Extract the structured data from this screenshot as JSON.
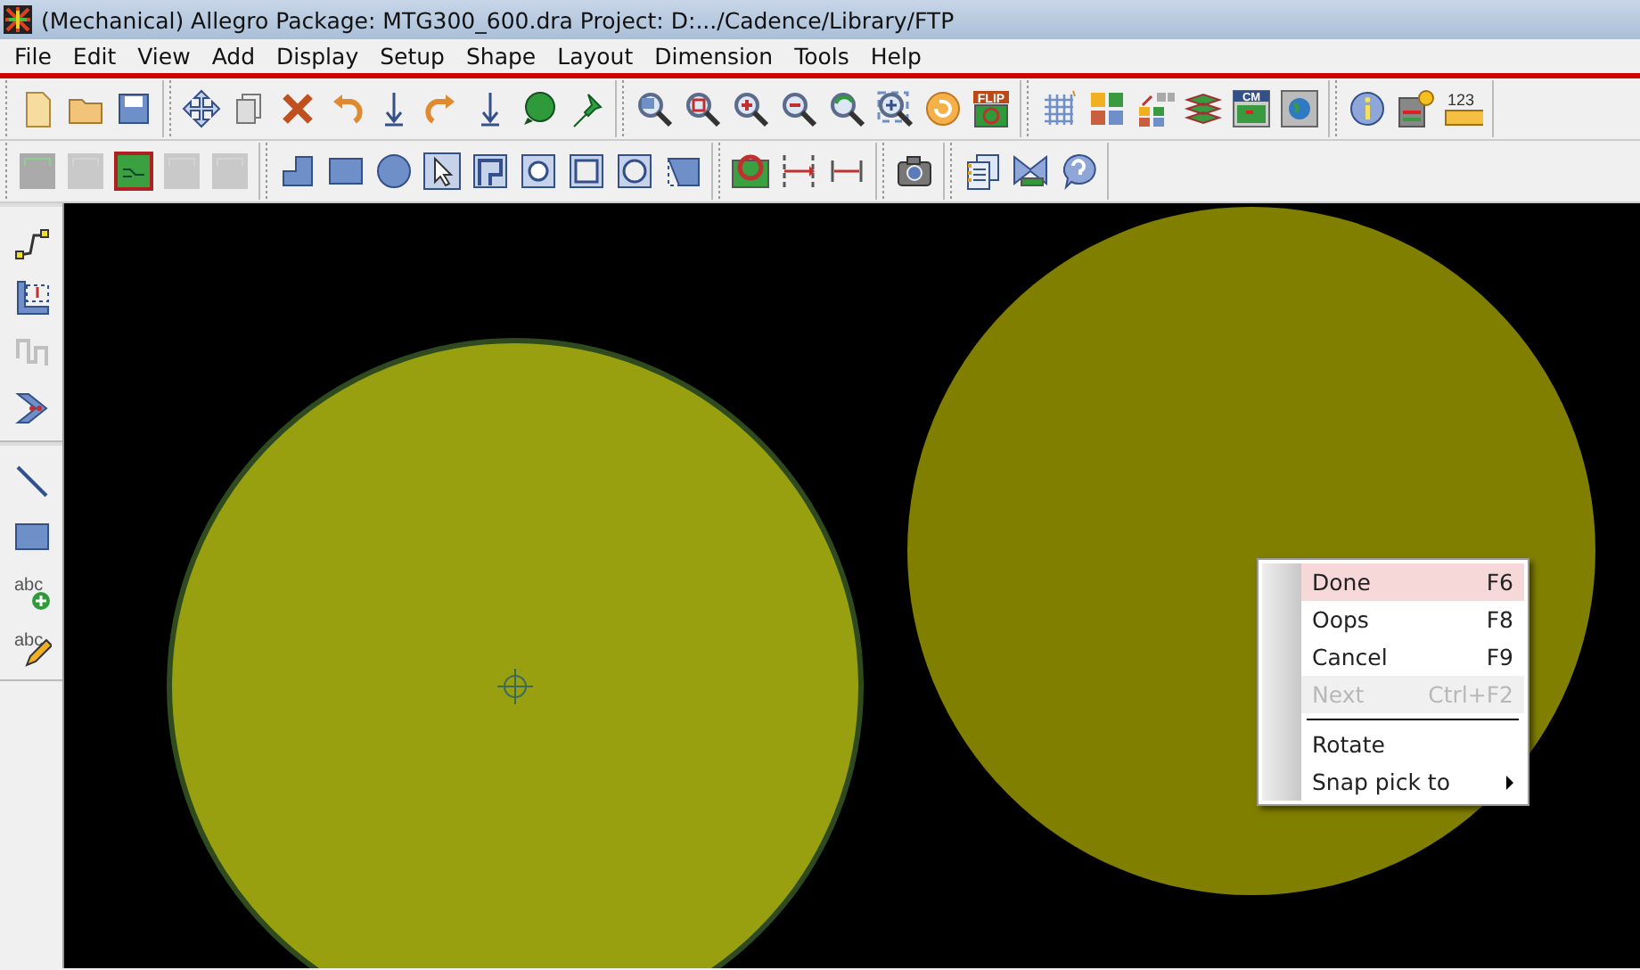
{
  "window": {
    "title": "(Mechanical) Allegro Package: MTG300_600.dra  Project: D:.../Cadence/Library/FTP"
  },
  "menu": [
    "File",
    "Edit",
    "View",
    "Add",
    "Display",
    "Setup",
    "Shape",
    "Layout",
    "Dimension",
    "Tools",
    "Help"
  ],
  "toolbar_1": [
    [
      {
        "kind": "page",
        "disabled": false
      },
      {
        "kind": "folder",
        "disabled": false
      },
      {
        "kind": "disk",
        "disabled": false
      }
    ],
    [
      {
        "kind": "move",
        "disabled": false
      },
      {
        "kind": "copy",
        "disabled": false
      },
      {
        "kind": "cross",
        "disabled": false
      },
      {
        "kind": "undo",
        "disabled": false
      },
      {
        "kind": "down",
        "disabled": false
      },
      {
        "kind": "redo",
        "disabled": false
      },
      {
        "kind": "down",
        "disabled": false
      },
      {
        "kind": "ball",
        "disabled": false
      },
      {
        "kind": "pin",
        "disabled": false
      }
    ],
    [
      {
        "kind": "zoomfit",
        "disabled": false
      },
      {
        "kind": "zoombox",
        "disabled": false
      },
      {
        "kind": "zoomin",
        "disabled": false
      },
      {
        "kind": "zoomout",
        "disabled": false
      },
      {
        "kind": "zoomprev",
        "disabled": false
      },
      {
        "kind": "zoomworld",
        "disabled": false
      },
      {
        "kind": "refresh",
        "disabled": false
      },
      {
        "kind": "badge",
        "text": "FLIP",
        "disabled": false
      }
    ],
    [
      {
        "kind": "grid",
        "disabled": false
      },
      {
        "kind": "colors",
        "disabled": false
      },
      {
        "kind": "colorsel",
        "disabled": false
      },
      {
        "kind": "stack",
        "disabled": false
      },
      {
        "kind": "sheet",
        "text": "CM",
        "disabled": false
      },
      {
        "kind": "globe",
        "disabled": false
      }
    ],
    [
      {
        "kind": "info",
        "disabled": false
      },
      {
        "kind": "infosheet",
        "disabled": false
      },
      {
        "kind": "ruler",
        "text": "123",
        "disabled": false
      }
    ]
  ],
  "toolbar_2": [
    [
      {
        "kind": "board",
        "disabled": false
      },
      {
        "kind": "board",
        "disabled": true
      },
      {
        "kind": "boardred",
        "disabled": false
      },
      {
        "kind": "board",
        "disabled": true
      },
      {
        "kind": "board",
        "disabled": true
      }
    ],
    [
      {
        "kind": "lshape",
        "disabled": false
      },
      {
        "kind": "rect",
        "disabled": false
      },
      {
        "kind": "circle",
        "disabled": false
      },
      {
        "kind": "select",
        "disabled": false
      },
      {
        "kind": "merge",
        "disabled": false
      },
      {
        "kind": "voidcircle",
        "disabled": false
      },
      {
        "kind": "square",
        "disabled": false
      },
      {
        "kind": "circlebox",
        "disabled": false
      },
      {
        "kind": "partial",
        "disabled": false
      }
    ],
    [
      {
        "kind": "boardring",
        "disabled": false
      },
      {
        "kind": "dim1",
        "disabled": false
      },
      {
        "kind": "dim2",
        "disabled": false
      }
    ],
    [
      {
        "kind": "camera",
        "disabled": false
      }
    ],
    [
      {
        "kind": "notes",
        "disabled": false
      },
      {
        "kind": "bowtie",
        "disabled": false
      },
      {
        "kind": "help",
        "disabled": false
      }
    ]
  ],
  "left_toolbar": [
    [
      {
        "kind": "connect",
        "disabled": false
      },
      {
        "kind": "dimrect",
        "disabled": false
      },
      {
        "kind": "wave",
        "disabled": true
      },
      {
        "kind": "chevron",
        "disabled": false
      }
    ],
    [
      {
        "kind": "line",
        "disabled": false
      },
      {
        "kind": "rect",
        "disabled": false
      },
      {
        "kind": "textadd",
        "text": "abc",
        "disabled": false
      },
      {
        "kind": "textedit",
        "text": "abc",
        "disabled": false
      }
    ]
  ],
  "context_menu": [
    {
      "kind": "item",
      "label": "Done",
      "shortcut": "F6",
      "selected": true,
      "disabled": false
    },
    {
      "kind": "item",
      "label": "Oops",
      "shortcut": "F8",
      "selected": false,
      "disabled": false
    },
    {
      "kind": "item",
      "label": "Cancel",
      "shortcut": "F9",
      "selected": false,
      "disabled": false
    },
    {
      "kind": "item",
      "label": "Next",
      "shortcut": "Ctrl+F2",
      "selected": false,
      "disabled": true
    },
    {
      "kind": "separator"
    },
    {
      "kind": "item",
      "label": "Rotate",
      "selected": false,
      "disabled": false
    },
    {
      "kind": "item",
      "label": "Snap pick to",
      "selected": false,
      "disabled": false,
      "submenu": true
    }
  ]
}
